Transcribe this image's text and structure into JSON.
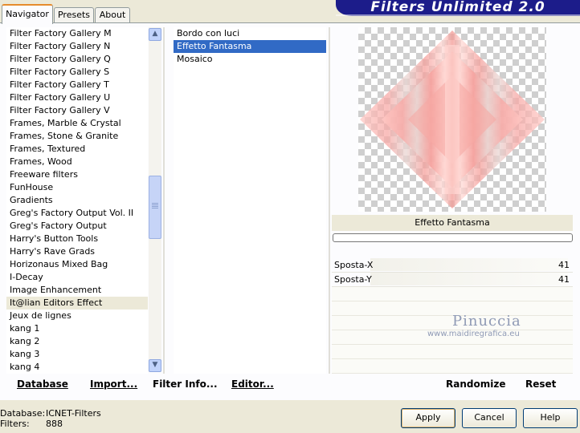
{
  "tabs": [
    {
      "label": "Navigator",
      "active": true
    },
    {
      "label": "Presets",
      "active": false
    },
    {
      "label": "About",
      "active": false
    }
  ],
  "banner_title": "Filters Unlimited 2.0",
  "categories": [
    "Filter Factory Gallery M",
    "Filter Factory Gallery N",
    "Filter Factory Gallery Q",
    "Filter Factory Gallery S",
    "Filter Factory Gallery T",
    "Filter Factory Gallery U",
    "Filter Factory Gallery V",
    "Frames, Marble & Crystal",
    "Frames, Stone & Granite",
    "Frames, Textured",
    "Frames, Wood",
    "Freeware filters",
    "FunHouse",
    "Gradients",
    "Greg's Factory Output Vol. II",
    "Greg's Factory Output",
    "Harry's Button Tools",
    "Harry's Rave Grads",
    "Horizonaus Mixed Bag",
    "I-Decay",
    "Image Enhancement",
    "It@lian Editors Effect",
    "Jeux de lignes",
    "kang 1",
    "kang 2",
    "kang 3",
    "kang 4"
  ],
  "selected_category": "It@lian Editors Effect",
  "filters": [
    "Bordo con luci",
    "Effetto Fantasma",
    "Mosaico"
  ],
  "selected_filter": "Effetto Fantasma",
  "current_filter_label": "Effetto Fantasma",
  "params": [
    {
      "name": "Sposta-X",
      "value": "41"
    },
    {
      "name": "Sposta-Y",
      "value": "41"
    }
  ],
  "watermark": {
    "name": "Pinuccia",
    "url": "www.maidiregrafica.eu"
  },
  "toolbar": {
    "database": "Database",
    "import": "Import...",
    "filter_info": "Filter Info...",
    "editor": "Editor...",
    "randomize": "Randomize",
    "reset": "Reset"
  },
  "status": {
    "database_label": "Database:",
    "database_value": "ICNET-Filters",
    "filters_label": "Filters:",
    "filters_value": "888"
  },
  "buttons": {
    "apply": "Apply",
    "cancel": "Cancel",
    "help": "Help"
  },
  "colors": {
    "banner": "#1c1c8a",
    "selection": "#316ac5"
  },
  "icons": {
    "scroll_up": "triangle-up",
    "scroll_down": "triangle-down"
  }
}
